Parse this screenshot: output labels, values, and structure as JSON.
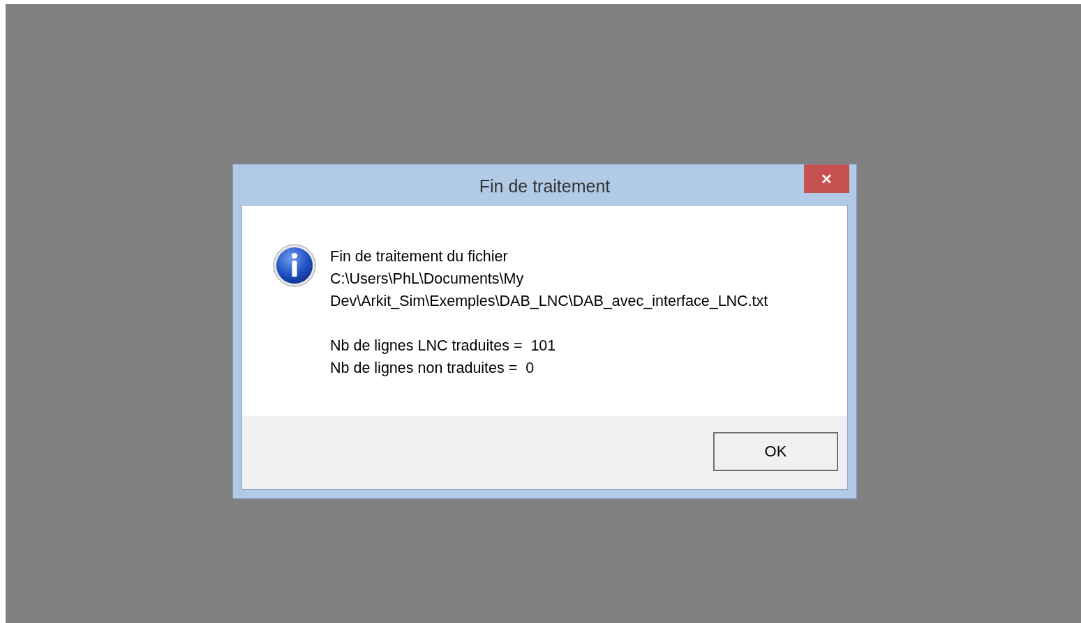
{
  "dialog": {
    "title": "Fin de traitement",
    "close_label": "✕",
    "message_paragraphs": [
      [
        "Fin de traitement du fichier",
        "C:\\Users\\PhL\\Documents\\My",
        "Dev\\Arkit_Sim\\Exemples\\DAB_LNC\\DAB_avec_interface_LNC.txt"
      ],
      [
        "Nb de lignes LNC traduites =  101",
        "Nb de lignes non traduites =  0"
      ]
    ],
    "buttons": [
      "OK"
    ]
  }
}
